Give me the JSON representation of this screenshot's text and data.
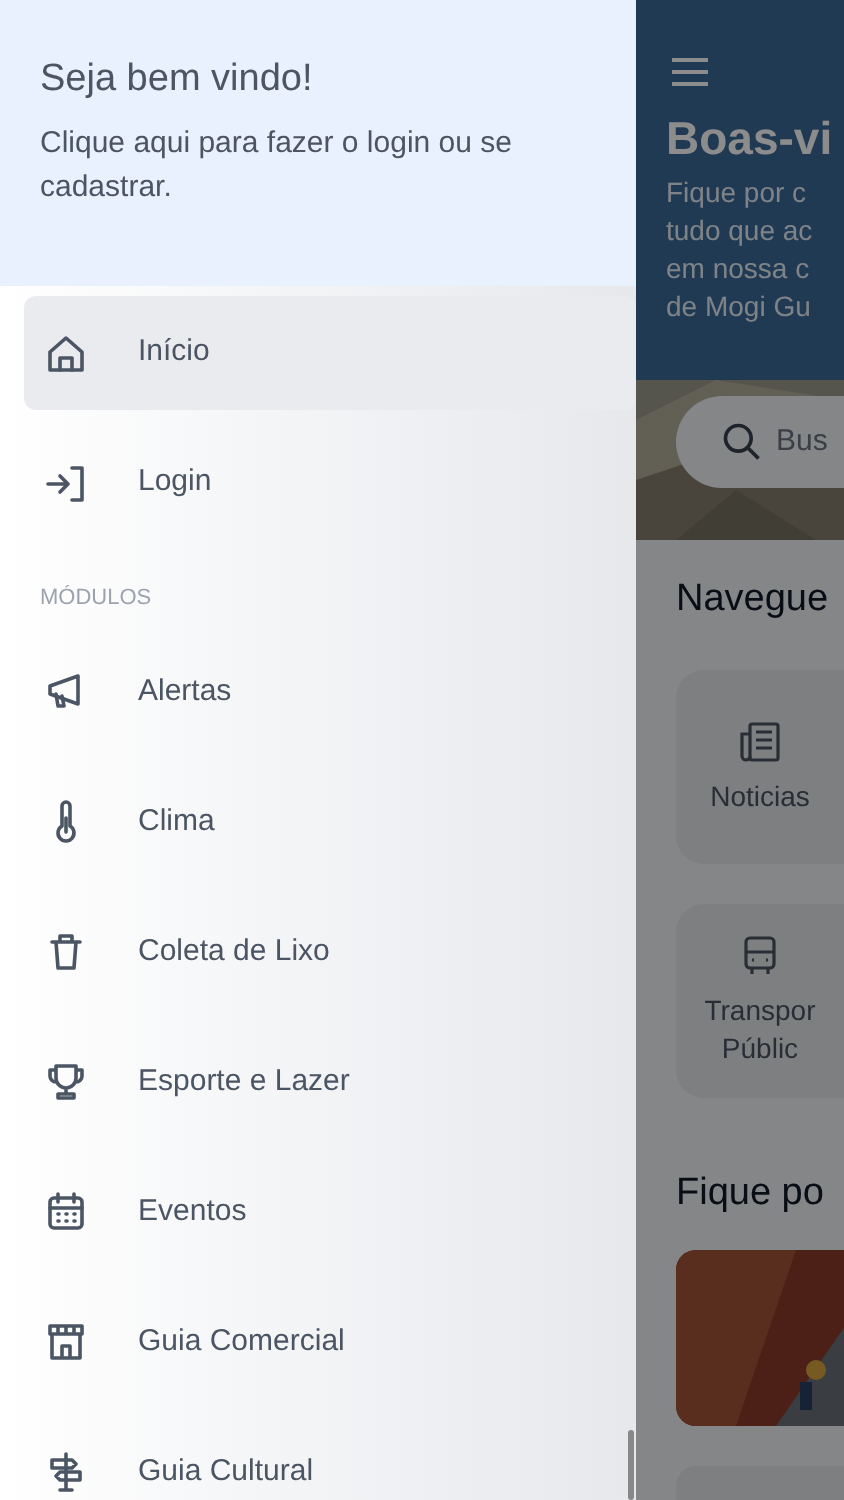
{
  "drawer": {
    "header": {
      "title": "Seja bem vindo!",
      "subtitle": "Clique aqui para fazer o login ou se cadastrar."
    },
    "nav": [
      {
        "label": "Início",
        "selected": true
      },
      {
        "label": "Login",
        "selected": false
      }
    ],
    "section_label": "MÓDULOS",
    "modules": [
      {
        "label": "Alertas"
      },
      {
        "label": "Clima"
      },
      {
        "label": "Coleta de Lixo"
      },
      {
        "label": "Esporte e Lazer"
      },
      {
        "label": "Eventos"
      },
      {
        "label": "Guia Comercial"
      },
      {
        "label": "Guia Cultural"
      }
    ]
  },
  "home_screen": {
    "title": "Boas-vi",
    "intro_lines": [
      "Fique por c",
      "tudo que ac",
      "em nossa c",
      "de Mogi Gu"
    ],
    "search_placeholder": "Bus",
    "section_title": "Navegue",
    "tiles": [
      {
        "label_lines": [
          "Noticias"
        ]
      },
      {
        "label_lines": [
          "Transpor",
          "Públic"
        ]
      }
    ],
    "news_title": "Fique po"
  }
}
